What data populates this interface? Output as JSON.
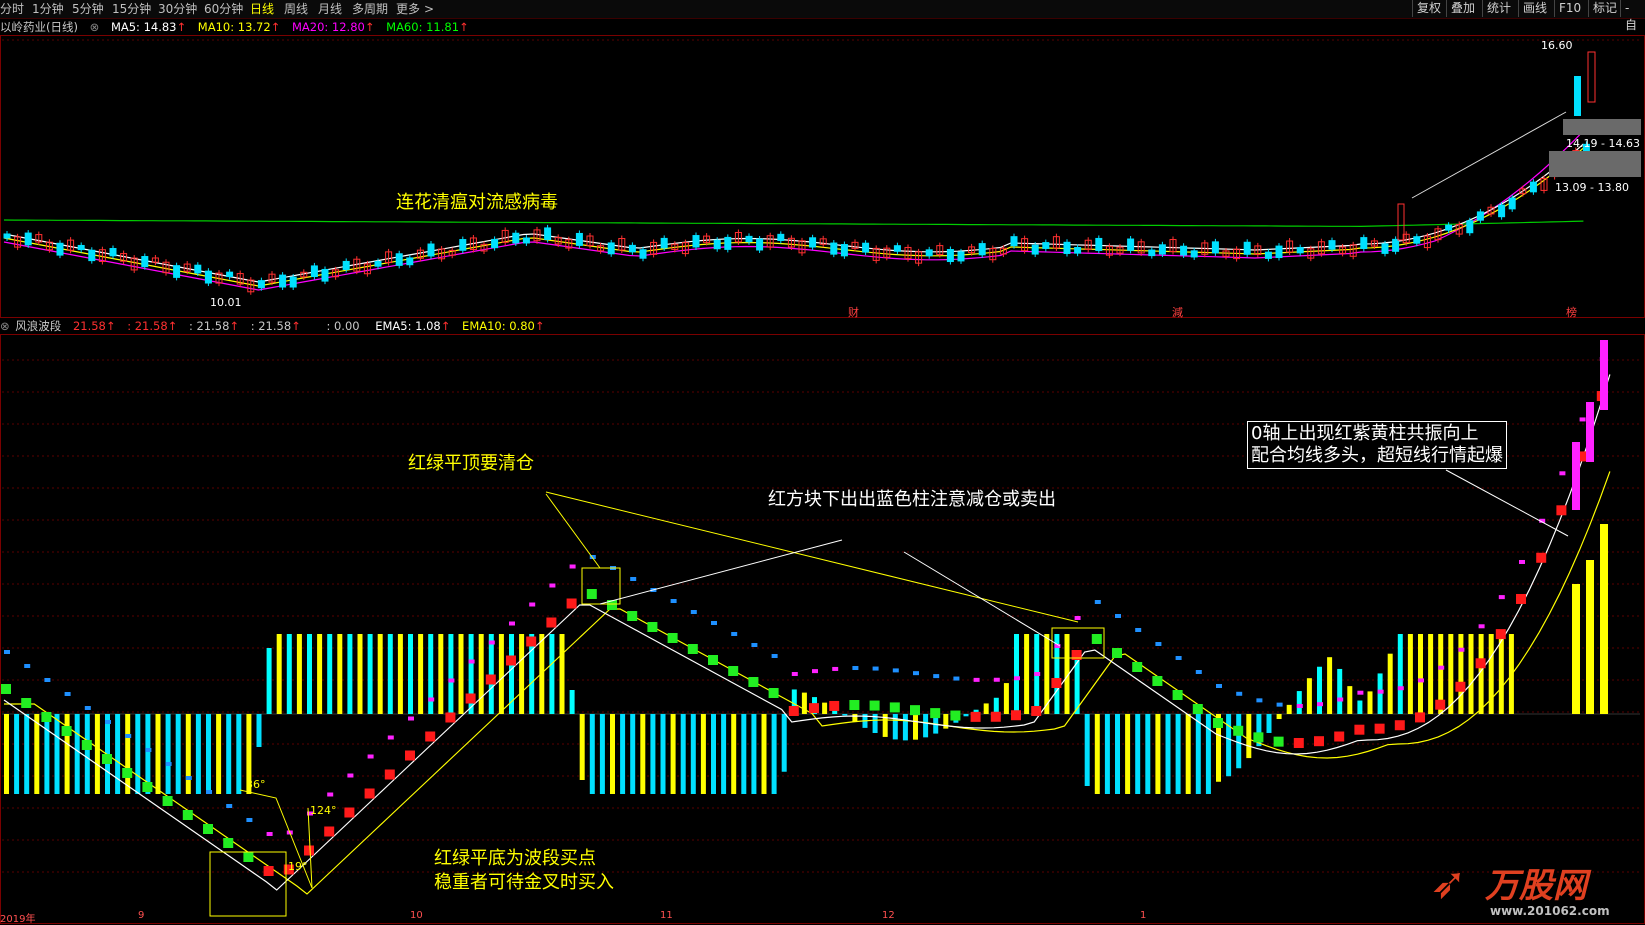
{
  "toolbar": {
    "tabs": [
      {
        "label": "分时",
        "active": false
      },
      {
        "label": "1分钟",
        "active": false
      },
      {
        "label": "5分钟",
        "active": false
      },
      {
        "label": "15分钟",
        "active": false
      },
      {
        "label": "30分钟",
        "active": false
      },
      {
        "label": "60分钟",
        "active": false
      },
      {
        "label": "日线",
        "active": true
      },
      {
        "label": "周线",
        "active": false
      },
      {
        "label": "月线",
        "active": false
      },
      {
        "label": "多周期",
        "active": false
      },
      {
        "label": "更多",
        "active": false
      }
    ],
    "more_arrow": ">",
    "right_buttons": [
      "复权",
      "叠加",
      "统计",
      "画线",
      "F10",
      "标记",
      "-自"
    ]
  },
  "main_legend": {
    "title": "以岭药业(日线)",
    "ma5": "MA5: 14.83",
    "ma10": "MA10: 13.72",
    "ma20": "MA20: 12.80",
    "ma60": "MA60: 11.81",
    "arrow": "↑",
    "colors": {
      "ma5": "#ffffff",
      "ma10": "#ffff00",
      "ma20": "#ff00ff",
      "ma60": "#00ff00"
    }
  },
  "price_labels": {
    "high": "16.60",
    "low": "10.01",
    "zone_upper": "14.19 - 14.63",
    "zone_lower": "13.09 - 13.80"
  },
  "event_markers": [
    "财",
    "減",
    "榜"
  ],
  "main_annotation": "连花清瘟对流感病毒",
  "indicator_legend": {
    "title": "风浪波段",
    "v1": "21.58",
    "v2": ": 21.58",
    "v3": ": 21.58",
    "v4": ": 21.58",
    "v5": ": 0.00",
    "ema5": "EMA5: 1.08",
    "ema10": "EMA10: 0.80",
    "arrow": "↑"
  },
  "indicator_annotations": {
    "top_sell": "红绿平顶要清仓",
    "blue_warn": "红方块下出出蓝色柱注意减仓或卖出",
    "bottom_buy_1": "红绿平底为波段买点",
    "bottom_buy_2": "稳重者可待金叉时买入",
    "resonance_1": "0轴上出现红紫黄柱共振向上",
    "resonance_2": "配合均线多头，超短线行情起爆",
    "angle_36": "36°",
    "angle_124": "124°",
    "angle_19": "19°"
  },
  "x_axis": [
    "2019年",
    "9",
    "10",
    "11",
    "12",
    "1"
  ],
  "watermark": {
    "brand": "万股网",
    "url": "www.201062.com"
  }
}
